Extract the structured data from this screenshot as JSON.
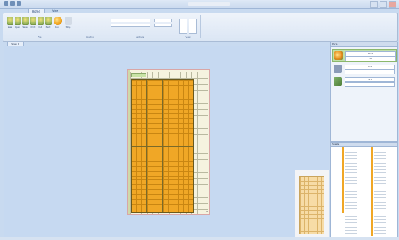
{
  "window": {
    "title": ""
  },
  "tabs": [
    "Home",
    "View"
  ],
  "ribbon": {
    "buttons": [
      "New",
      "Open",
      "Save",
      "Print",
      "Cut",
      "Nest",
      "Run",
      "Stop"
    ],
    "groups": [
      "File",
      "Nesting",
      "Settings",
      "View"
    ]
  },
  "document_tab": "Sheet 1",
  "sheet": {
    "corner_label": "8"
  },
  "parts_panel": {
    "title": "Parts",
    "rows": [
      {
        "label": "Part",
        "value": "16"
      },
      {
        "label": "Part",
        "value": ""
      },
      {
        "label": "Part",
        "value": ""
      }
    ]
  },
  "list_panel": {
    "title": "Sheets"
  },
  "status": {
    "text": ""
  },
  "colors": {
    "accent": "#f0a726",
    "selection": "#bfe0a8",
    "background": "#c6d9f1"
  }
}
